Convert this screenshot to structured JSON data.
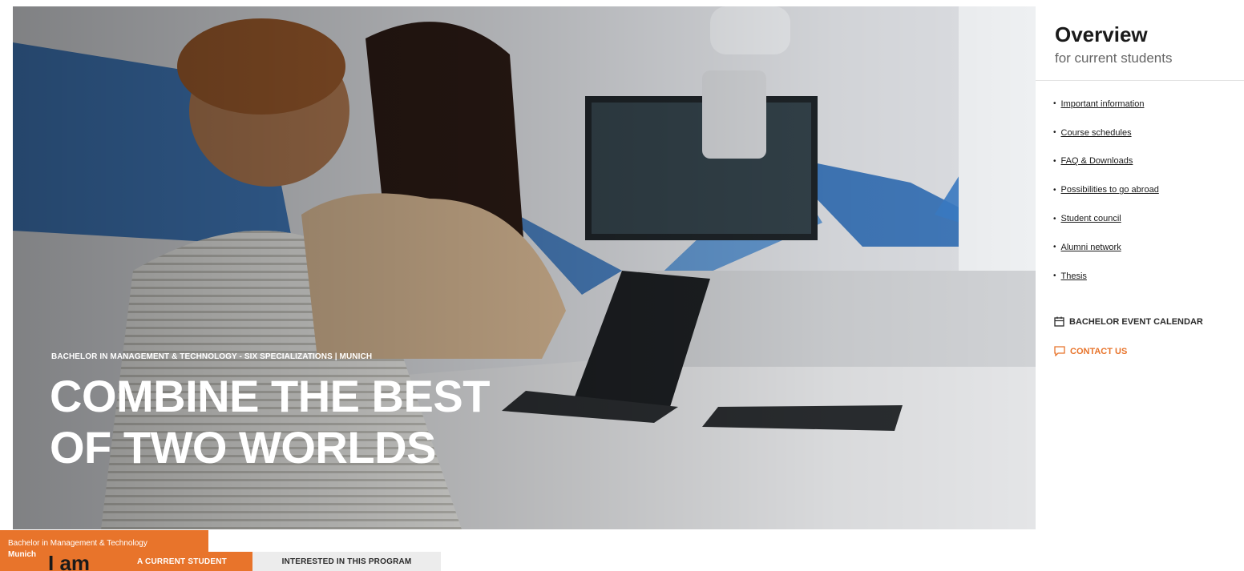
{
  "hero": {
    "eyebrow": "BACHELOR IN MANAGEMENT & TECHNOLOGY - SIX SPECIALIZATIONS | MUNICH",
    "title_line1": "COMBINE THE BEST",
    "title_line2": "OF TWO WORLDS"
  },
  "sidebar": {
    "title": "Overview",
    "subtitle": "for current students",
    "links": [
      {
        "label": "Important information"
      },
      {
        "label": "Course schedules"
      },
      {
        "label": "FAQ & Downloads"
      },
      {
        "label": "Possibilities to go abroad"
      },
      {
        "label": "Student council"
      },
      {
        "label": "Alumni network"
      },
      {
        "label": "Thesis"
      }
    ],
    "calendar_label": "BACHELOR EVENT CALENDAR",
    "contact_label": "CONTACT US",
    "footer_line1": "Bachelor in Management & Technology",
    "footer_line2": "Munich"
  },
  "selector": {
    "prefix": "I am",
    "option_current": "A CURRENT STUDENT",
    "option_interested": "INTERESTED IN THIS PROGRAM"
  },
  "colors": {
    "accent": "#e8742b",
    "blue_shape": "#2f6db5",
    "inactive_tab": "#ececec"
  }
}
